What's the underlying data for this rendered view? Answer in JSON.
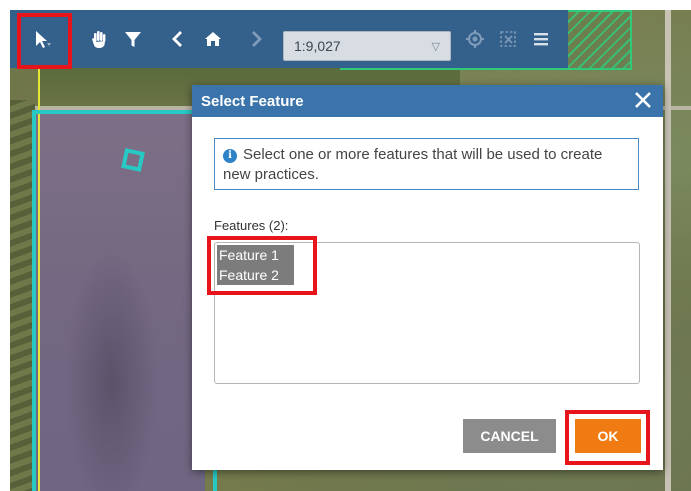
{
  "toolbar": {
    "tools": [
      {
        "name": "select-tool",
        "icon": "cursor-arrow-icon"
      },
      {
        "name": "pan-tool",
        "icon": "hand-icon"
      },
      {
        "name": "filter-tool",
        "icon": "funnel-icon"
      },
      {
        "name": "back-button",
        "icon": "chevron-left-icon"
      },
      {
        "name": "home-button",
        "icon": "home-icon"
      },
      {
        "name": "forward-button",
        "icon": "chevron-right-icon"
      }
    ],
    "scale": "1:9,027",
    "right_tools": [
      {
        "name": "locate-button",
        "icon": "crosshair-icon"
      },
      {
        "name": "clear-selection-button",
        "icon": "clear-selection-icon"
      },
      {
        "name": "menu-button",
        "icon": "hamburger-menu-icon"
      }
    ]
  },
  "dialog": {
    "title": "Select Feature",
    "info_text": "Select one or more features that will be used to create new practices.",
    "features_label": "Features (2):",
    "features": [
      "Feature 1",
      "Feature 2"
    ],
    "cancel_label": "CANCEL",
    "ok_label": "OK"
  },
  "colors": {
    "toolbar_bg": "#34608c",
    "dialog_titlebar": "#3a74aa",
    "ok_button": "#f07b12",
    "cancel_button": "#8c8c8c",
    "highlight": "#e8141c",
    "field_boundary": "#28c9c4"
  }
}
